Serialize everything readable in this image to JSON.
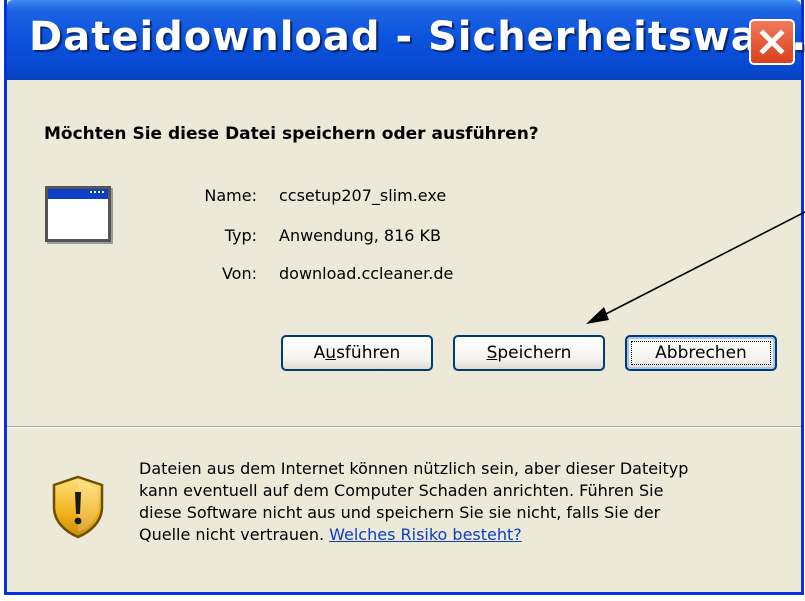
{
  "dialog": {
    "title": "Dateidownload - Sicherheitswa...",
    "question": "Möchten Sie diese Datei speichern oder ausführen?",
    "file": {
      "name_label": "Name:",
      "name_value": "ccsetup207_slim.exe",
      "type_label": "Typ:",
      "type_value": "Anwendung, 816 KB",
      "from_label": "Von:",
      "from_value": "download.ccleaner.de"
    },
    "buttons": {
      "run": {
        "pre": "A",
        "accel": "u",
        "post": "sführen"
      },
      "save": {
        "pre": "",
        "accel": "S",
        "post": "peichern"
      },
      "cancel": "Abbrechen"
    },
    "warning": {
      "line1": "Dateien aus dem Internet können nützlich sein, aber dieser Dateityp",
      "line2": "kann eventuell auf dem Computer Schaden anrichten. Führen Sie",
      "line3": "diese Software nicht aus und speichern Sie sie nicht, falls Sie der",
      "line4_text": "Quelle nicht vertrauen. ",
      "link": "Welches Risiko besteht?"
    }
  },
  "icons": {
    "close": "close-x-icon",
    "file": "application-window-icon",
    "warning": "security-shield-icon"
  },
  "colors": {
    "titlebar": "#0a52dc",
    "close_button": "#e0512d",
    "window_bg": "#ece9d8",
    "link": "#0b3fc4"
  }
}
